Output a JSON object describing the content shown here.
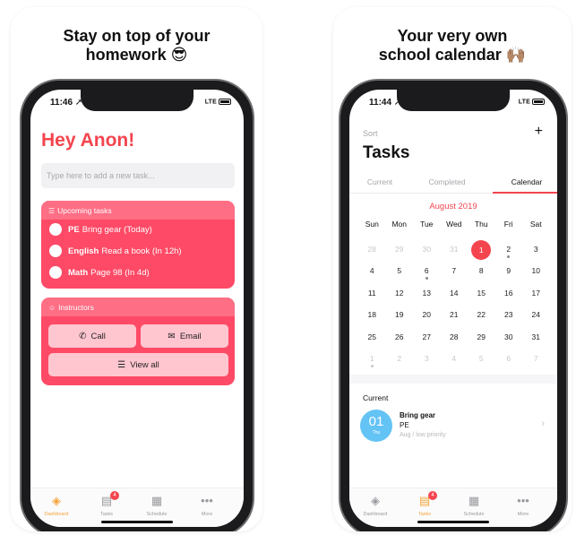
{
  "left_card": {
    "headline_line1": "Stay on top of your",
    "headline_line2": "homework 😎",
    "time": "11:46 ➚",
    "signal": "LTE",
    "greeting": "Hey Anon!",
    "new_task_placeholder": "Type here to add a new task...",
    "upcoming": {
      "title": "Upcoming tasks",
      "items": [
        {
          "subject": "PE",
          "text": "Bring gear (Today)"
        },
        {
          "subject": "English",
          "text": "Read a book (In 12h)"
        },
        {
          "subject": "Math",
          "text": "Page 98 (In 4d)"
        }
      ]
    },
    "instructors": {
      "title": "Instructors",
      "call_label": "Call",
      "email_label": "Email",
      "view_all_label": "View all"
    },
    "tabbar": [
      {
        "label": "Dashboard",
        "icon": "stack-icon",
        "active": true
      },
      {
        "label": "Tasks",
        "icon": "tasks-icon",
        "badge": "4"
      },
      {
        "label": "Schedule",
        "icon": "calendar-icon"
      },
      {
        "label": "More",
        "icon": "more-icon"
      }
    ]
  },
  "right_card": {
    "headline_line1": "Your very own",
    "headline_line2": "school calendar 🙌🏽",
    "time": "11:44 ➚",
    "signal": "LTE",
    "sort_label": "Sort",
    "add_label": "+",
    "title": "Tasks",
    "tabs": [
      "Current",
      "Completed",
      "Calendar"
    ],
    "active_tab": "Calendar",
    "month": "August 2019",
    "weekdays": [
      "Sun",
      "Mon",
      "Tue",
      "Wed",
      "Thu",
      "Fri",
      "Sat"
    ],
    "weeks": [
      [
        "28",
        "29",
        "30",
        "31",
        "1",
        "2",
        "3"
      ],
      [
        "4",
        "5",
        "6",
        "7",
        "8",
        "9",
        "10"
      ],
      [
        "11",
        "12",
        "13",
        "14",
        "15",
        "16",
        "17"
      ],
      [
        "18",
        "19",
        "20",
        "21",
        "22",
        "23",
        "24"
      ],
      [
        "25",
        "26",
        "27",
        "28",
        "29",
        "30",
        "31"
      ],
      [
        "1",
        "2",
        "3",
        "4",
        "5",
        "6",
        "7"
      ]
    ],
    "current_label": "Current",
    "task": {
      "day": "01",
      "weekday": "Thu",
      "title": "Bring gear",
      "subject": "PE",
      "meta": "Aug / low priority"
    },
    "tabbar": [
      {
        "label": "Dashboard",
        "icon": "stack-icon"
      },
      {
        "label": "Tasks",
        "icon": "tasks-icon",
        "badge": "4",
        "active": true
      },
      {
        "label": "Schedule",
        "icon": "calendar-icon"
      },
      {
        "label": "More",
        "icon": "more-icon"
      }
    ]
  },
  "colors": {
    "accent_red": "#f4454f",
    "panel_pink": "#fe4a66",
    "tab_active_orange": "#f3a43b",
    "task_bubble_blue": "#64c3f5"
  }
}
